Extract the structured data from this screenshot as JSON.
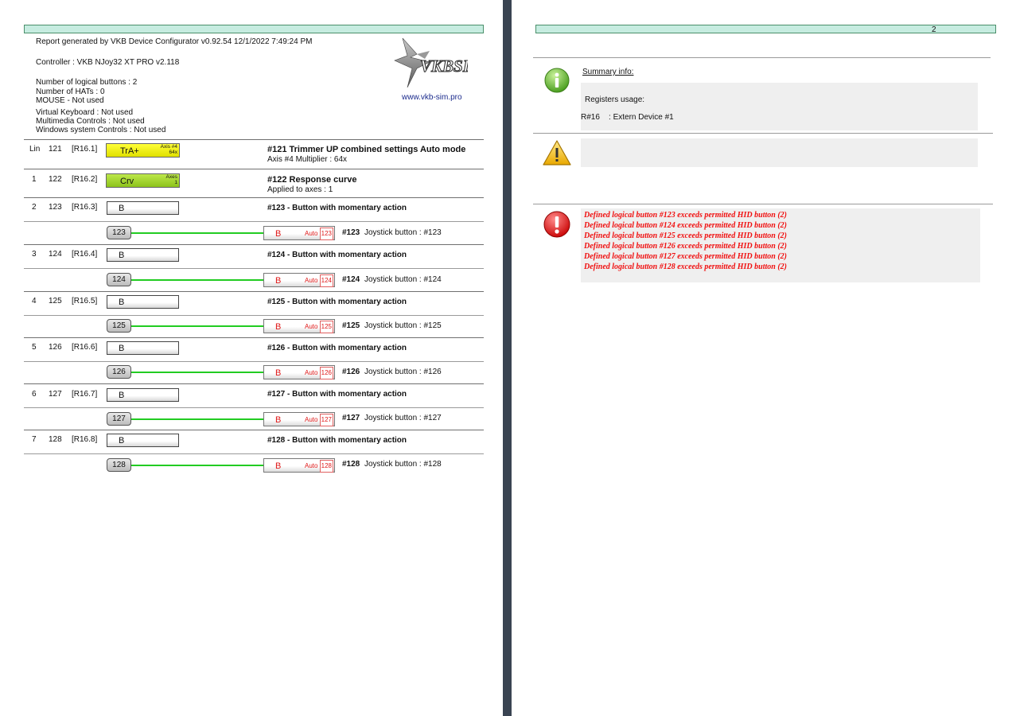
{
  "page1": {
    "report_line": "Report generated by VKB Device Configurator v0.92.54  12/1/2022  7:49:24 PM",
    "controller_line": "Controller : VKB NJoy32 XT PRO  v2.118",
    "info_lines": [
      "Number of logical buttons : 2",
      "Number of HATs : 0",
      "MOUSE - Not used",
      "Virtual Keyboard : Not used",
      "Multimedia Controls : Not used",
      "Windows system Controls : Not used"
    ],
    "logo_text": "VKBSIM",
    "website": "www.vkb-sim.pro",
    "rows": [
      {
        "num": "Lin",
        "id": "121",
        "reg": "[R16.1]",
        "box_label": "TrA+",
        "box_sub1": "Axis #4",
        "box_sub2": "64x",
        "title": "#121 Trimmer UP combined settings Auto mode",
        "sub": "Axis #4 Multiplier : 64x"
      },
      {
        "num": "1",
        "id": "122",
        "reg": "[R16.2]",
        "box_label": "Crv",
        "box_sub1": "Axes",
        "box_sub2": "1",
        "title": "#122 Response curve",
        "sub": "Applied to axes : 1"
      }
    ],
    "buttons": [
      {
        "num": "2",
        "id": "123",
        "reg": "[R16.3]",
        "box_label": "B",
        "title": "#123 - Button with momentary action",
        "pill": "123",
        "red_b": "B",
        "auto": "Auto",
        "auto_num": "123",
        "desc_bold": "#123",
        "desc": "Joystick button : #123"
      },
      {
        "num": "3",
        "id": "124",
        "reg": "[R16.4]",
        "box_label": "B",
        "title": "#124 - Button with momentary action",
        "pill": "124",
        "red_b": "B",
        "auto": "Auto",
        "auto_num": "124",
        "desc_bold": "#124",
        "desc": "Joystick button : #124"
      },
      {
        "num": "4",
        "id": "125",
        "reg": "[R16.5]",
        "box_label": "B",
        "title": "#125 - Button with momentary action",
        "pill": "125",
        "red_b": "B",
        "auto": "Auto",
        "auto_num": "125",
        "desc_bold": "#125",
        "desc": "Joystick button : #125"
      },
      {
        "num": "5",
        "id": "126",
        "reg": "[R16.6]",
        "box_label": "B",
        "title": "#126 - Button with momentary action",
        "pill": "126",
        "red_b": "B",
        "auto": "Auto",
        "auto_num": "126",
        "desc_bold": "#126",
        "desc": "Joystick button : #126"
      },
      {
        "num": "6",
        "id": "127",
        "reg": "[R16.7]",
        "box_label": "B",
        "title": "#127 - Button with momentary action",
        "pill": "127",
        "red_b": "B",
        "auto": "Auto",
        "auto_num": "127",
        "desc_bold": "#127",
        "desc": "Joystick button : #127"
      },
      {
        "num": "7",
        "id": "128",
        "reg": "[R16.8]",
        "box_label": "B",
        "title": "#128 - Button with momentary action",
        "pill": "128",
        "red_b": "B",
        "auto": "Auto",
        "auto_num": "128",
        "desc_bold": "#128",
        "desc": "Joystick button : #128"
      }
    ]
  },
  "page2": {
    "page_number": "2",
    "summary_title": "Summary info:",
    "registers_label": "Registers usage:",
    "register_line": "R#16    : Extern Device #1",
    "errors": [
      "Defined logical button #123 exceeds permitted HID button (2)",
      "Defined logical button #124 exceeds permitted HID button (2)",
      "Defined logical button #125 exceeds permitted HID button (2)",
      "Defined logical button #126 exceeds permitted HID button (2)",
      "Defined logical button #127 exceeds permitted HID button (2)",
      "Defined logical button #128 exceeds permitted HID button (2)"
    ],
    "icons": [
      "info-icon",
      "warning-icon",
      "error-icon"
    ]
  },
  "colors": {
    "header_bar": "#c6ece0",
    "link_line": "#22cc22",
    "error_text": "#f01010",
    "trim_box": "#ffff38",
    "curve_box": "#a6d832"
  }
}
